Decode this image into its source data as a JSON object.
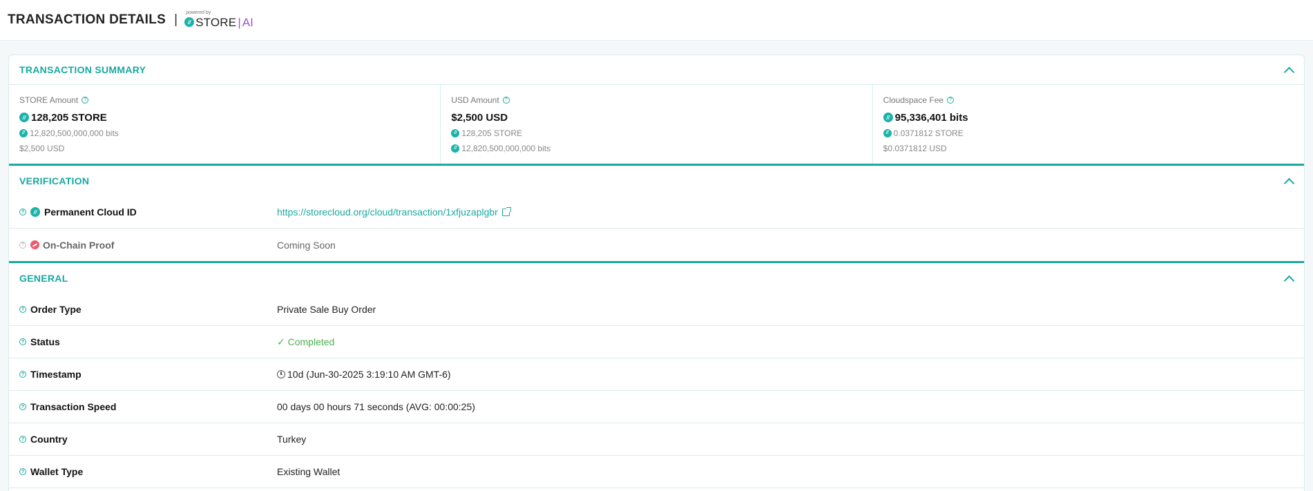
{
  "header": {
    "title": "TRANSACTION DETAILS",
    "separator": "|",
    "powered_by": "powered by",
    "brand_store": "STORE",
    "brand_bar": "|",
    "brand_ai": "AI"
  },
  "summary": {
    "title": "TRANSACTION SUMMARY",
    "cells": [
      {
        "label": "STORE Amount",
        "main": "128,205 STORE",
        "sub1": "12,820,500,000,000 bits",
        "sub2": "$2,500 USD"
      },
      {
        "label": "USD Amount",
        "main": "$2,500 USD",
        "sub1": "128,205 STORE",
        "sub2": "12,820,500,000,000 bits"
      },
      {
        "label": "Cloudspace Fee",
        "main": "95,336,401 bits",
        "sub1": "0.0371812 STORE",
        "sub2": "$0.0371812 USD"
      }
    ]
  },
  "verification": {
    "title": "VERIFICATION",
    "rows": [
      {
        "label": "Permanent Cloud ID",
        "value": "https://storecloud.org/cloud/transaction/1xfjuzaplgbr"
      },
      {
        "label": "On-Chain Proof",
        "value": "Coming Soon"
      }
    ]
  },
  "general": {
    "title": "GENERAL",
    "rows": [
      {
        "label": "Order Type",
        "value": "Private Sale Buy Order"
      },
      {
        "label": "Status",
        "value": "✓ Completed"
      },
      {
        "label": "Timestamp",
        "value": "10d (Jun-30-2025 3:19:10 AM GMT-6)"
      },
      {
        "label": "Transaction Speed",
        "value": "00 days 00 hours 71 seconds (AVG: 00:00:25)"
      },
      {
        "label": "Country",
        "value": "Turkey"
      },
      {
        "label": "Wallet Type",
        "value": "Existing Wallet"
      }
    ]
  },
  "icons": {
    "help": "help-circle-icon",
    "coin": "store-coin-icon",
    "chevron": "chevron-up-icon",
    "external": "external-link-icon",
    "clock": "clock-icon",
    "blocked": "on-chain-status-icon"
  },
  "colors": {
    "accent": "#17a9a0",
    "success": "#4caf50",
    "brand_ai": "#9b59d0",
    "alert": "#ef5a6f"
  }
}
